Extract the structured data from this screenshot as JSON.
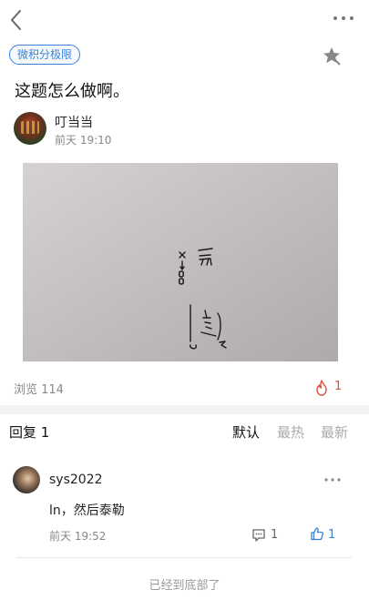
{
  "header": {
    "back_icon": "chevron-left-icon",
    "more_icon": "more-horizontal-icon"
  },
  "post": {
    "tag": "微积分极限",
    "title": "这题怎么做啊。",
    "author": "叮当当",
    "time": "前天 19:10",
    "bookmark_icon": "star-icon",
    "views_label": "浏览 114",
    "fire_icon": "fire-icon",
    "fire_count": "1"
  },
  "replies": {
    "header": "回复 1",
    "sort": {
      "default": "默认",
      "hot": "最热",
      "new": "最新"
    },
    "items": [
      {
        "user": "sys2022",
        "text": "ln，然后泰勒",
        "time": "前天 19:52",
        "comment_count": "1",
        "like_count": "1"
      }
    ]
  },
  "footer": "已经到底部了",
  "colors": {
    "accent": "#3a80d6",
    "fire": "#e0523c",
    "muted": "#888888"
  }
}
